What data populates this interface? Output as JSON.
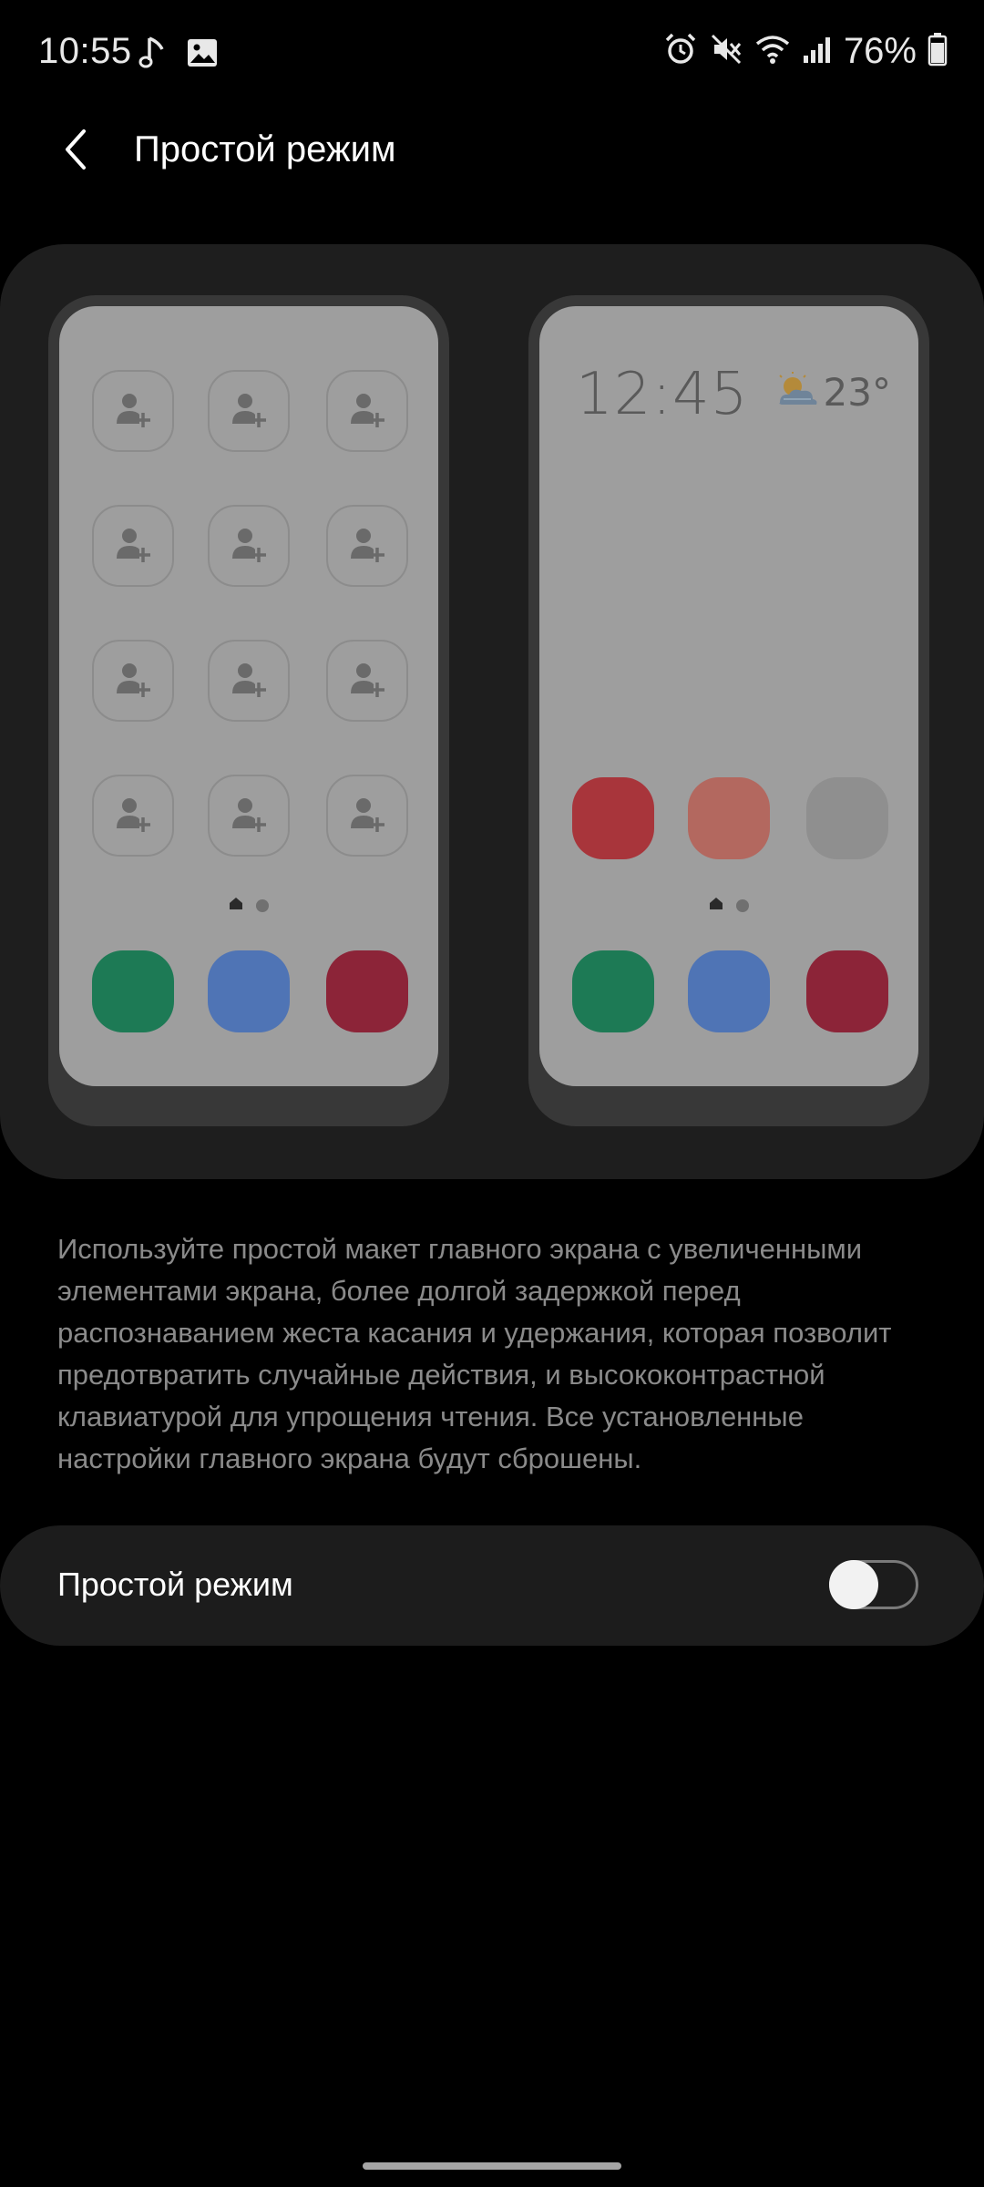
{
  "status_bar": {
    "time": "10:55",
    "battery_percent": "76%",
    "battery_level": 0.76,
    "left_icons": [
      "music-note-icon",
      "image-icon"
    ],
    "right_icons": [
      "alarm-icon",
      "mute-icon",
      "wifi-icon",
      "signal-icon",
      "battery-icon"
    ]
  },
  "app_bar": {
    "title": "Простой режим",
    "back_icon": "chevron-left-icon"
  },
  "preview": {
    "left_phone": {
      "contact_icon": "add-contact-icon",
      "dock_colors": [
        "#1d7a55",
        "#4f74b5",
        "#8c2438"
      ]
    },
    "right_phone": {
      "clock": "12:45",
      "temperature": "23°",
      "weather_icon": "partly-cloudy-icon",
      "app_colors": [
        "#a8353b",
        "#b3685f",
        "#8f8f8f"
      ],
      "dock_colors": [
        "#1d7a55",
        "#4f74b5",
        "#8c2438"
      ]
    }
  },
  "description": "Используйте простой макет главного экрана с увеличенными элементами экрана, более долгой задержкой перед распознаванием жеста касания и удержания, которая позволит предотвратить случайные действия, и высококонтрастной клавиатурой для упрощения чтения. Все установленные настройки главного экрана будут сброшены.",
  "toggle": {
    "label": "Простой режим",
    "state": "off"
  }
}
